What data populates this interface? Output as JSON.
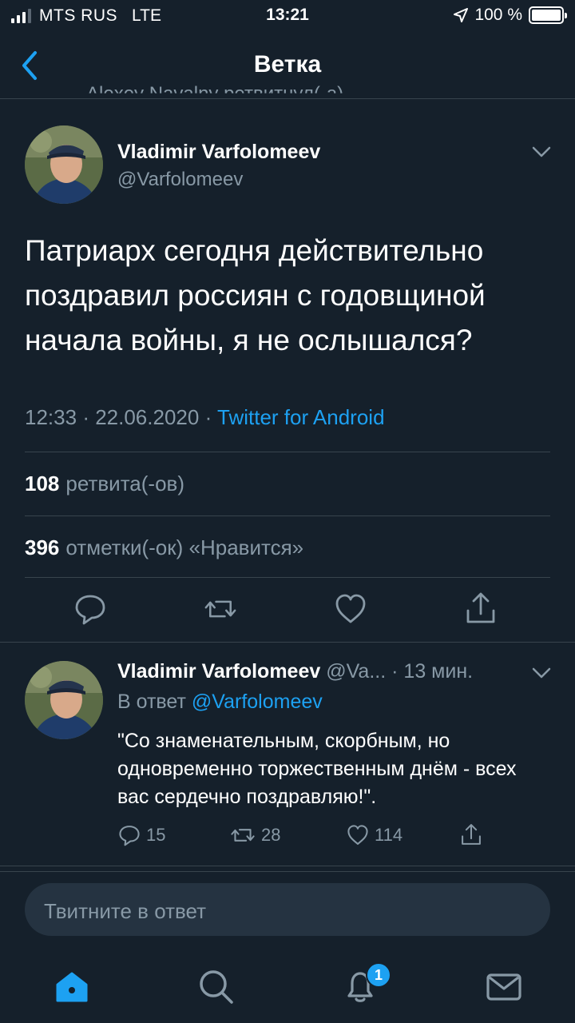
{
  "status_bar": {
    "carrier": "MTS RUS",
    "network": "LTE",
    "time": "13:21",
    "battery": "100 %"
  },
  "nav": {
    "title": "Ветка"
  },
  "retweeted_by": "Alexey Navalny ретвитнул(-а)",
  "main_tweet": {
    "name": "Vladimir Varfolomeev",
    "handle": "@Varfolomeev",
    "text": "Патриарх сегодня действительно поздравил россиян с годовщиной начала войны, я не ослышался?",
    "time": "12:33",
    "date": "22.06.2020",
    "source": "Twitter for Android",
    "retweets_count": "108",
    "retweets_label": "ретвита(-ов)",
    "likes_count": "396",
    "likes_label": "отметки(-ок) «Нравится»"
  },
  "reply_tweet": {
    "name": "Vladimir Varfolomeev",
    "handle": "@Va...",
    "time": "· 13 мин.",
    "reply_to_label": "В ответ",
    "reply_to_handle": "@Varfolomeev",
    "text": "\"Со знаменательным, скорбным, но одновременно торжественным днём - всех вас сердечно поздравляю!\".",
    "replies": "15",
    "retweets": "28",
    "likes": "114"
  },
  "composer": {
    "placeholder": "Твитните в ответ"
  },
  "tab_bar": {
    "notifications_badge": "1"
  },
  "colors": {
    "background": "#15202b",
    "accent": "#1da1f2",
    "secondary_text": "#8899a6",
    "divider": "#38444d"
  },
  "icons": [
    "back-chevron-icon",
    "caret-down-icon",
    "reply-icon",
    "retweet-icon",
    "like-icon",
    "share-icon",
    "home-icon",
    "search-icon",
    "bell-icon",
    "mail-icon"
  ]
}
